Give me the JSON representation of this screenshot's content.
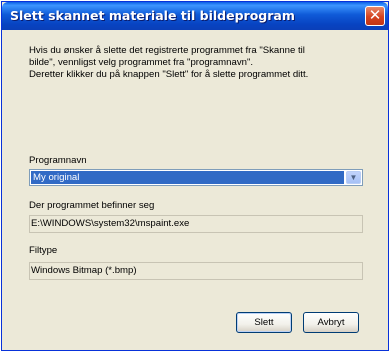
{
  "dialog": {
    "title": "Slett skannet materiale til bildeprogram",
    "close_icon": "close-icon"
  },
  "description": {
    "line1": "Hvis du ønsker å slette det registrerte programmet fra \"Skanne til",
    "line2": "bilde\", vennligst velg programmet fra \"programnavn\".",
    "line3": "Deretter klikker du på knappen \"Slett\" for å slette programmet ditt."
  },
  "program_name": {
    "label": "Programnavn",
    "selected_value": "My original"
  },
  "program_location": {
    "label": "Der programmet befinner seg",
    "value": "E:\\WINDOWS\\system32\\mspaint.exe"
  },
  "file_type": {
    "label": "Filtype",
    "value": "Windows Bitmap (*.bmp)"
  },
  "buttons": {
    "delete_label": "Slett",
    "cancel_label": "Avbryt"
  },
  "colors": {
    "titlebar": "#0a5fe6",
    "selection": "#316ac5",
    "dialog_bg": "#ece9d8",
    "close_button": "#d4421f"
  }
}
